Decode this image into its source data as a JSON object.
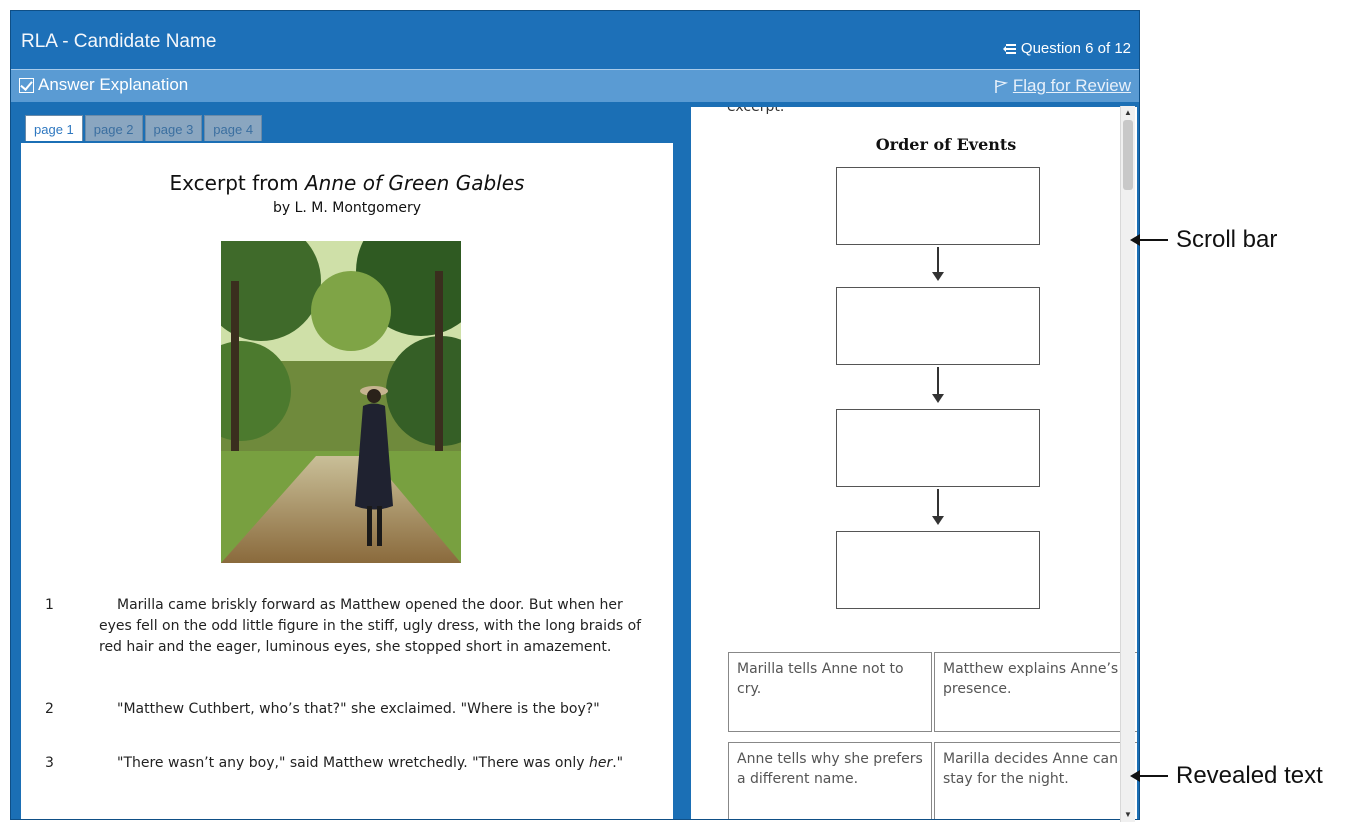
{
  "window": {
    "title": "RLA - Candidate Name",
    "question_counter": "Question 6 of 12"
  },
  "toolbar": {
    "answer_explanation": "Answer Explanation",
    "flag_for_review": "Flag for Review"
  },
  "passage": {
    "tabs": [
      "page 1",
      "page 2",
      "page 3",
      "page 4"
    ],
    "active_tab": "page 1",
    "title_prefix": "Excerpt from ",
    "title_book": "Anne of Green Gables",
    "author": "by L. M. Montgomery",
    "paragraphs": [
      {
        "num": "1",
        "text": "Marilla came briskly forward as Matthew opened the door. But when her eyes fell on the odd little figure in the stiff, ugly dress, with the long braids of red hair and the eager, luminous eyes, she stopped short in amazement."
      },
      {
        "num": "2",
        "text": "\"Matthew Cuthbert, who’s that?\" she exclaimed. \"Where is the boy?\""
      },
      {
        "num": "3",
        "text_before": "\"There wasn’t any boy,\" said Matthew wretchedly. \"There was only ",
        "text_em": "her",
        "text_after": ".\""
      }
    ]
  },
  "question": {
    "cutoff_text": "excerpt.",
    "diagram_title": "Order of Events",
    "answer_options": [
      "Marilla tells Anne not to cry.",
      "Matthew explains Anne’s presence.",
      "Anne tells why she prefers a different name.",
      "Marilla decides Anne can stay for the night."
    ]
  },
  "callouts": {
    "scroll_bar": "Scroll bar",
    "revealed_text": "Revealed text"
  },
  "colors": {
    "header_blue": "#1d70b8",
    "toolbar_blue": "#5a9bd3",
    "frame_blue": "#1b6fb5"
  }
}
